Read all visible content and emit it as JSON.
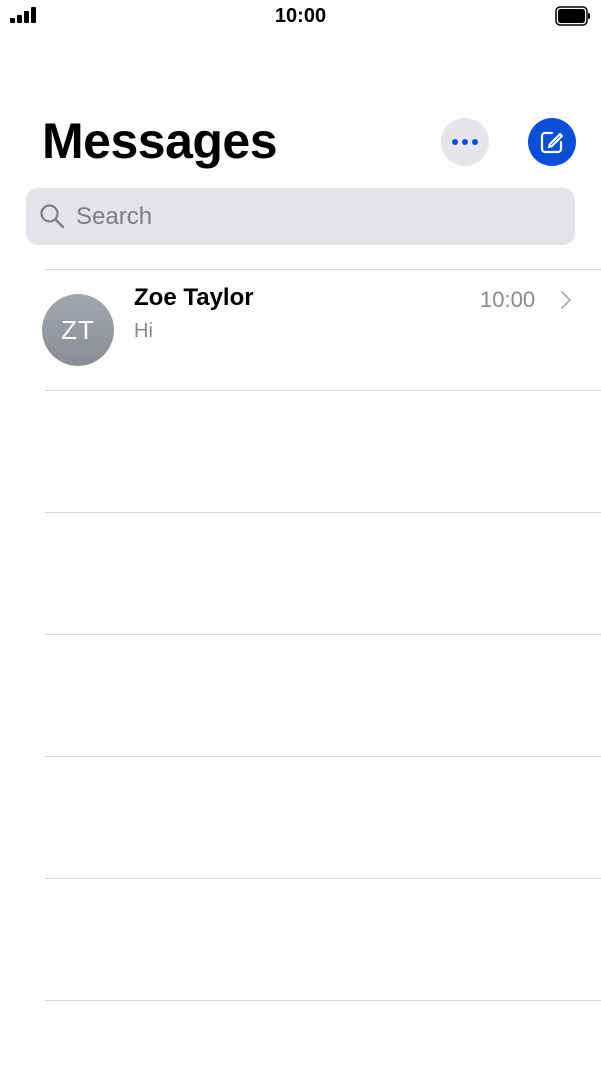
{
  "status_bar": {
    "time": "10:00"
  },
  "header": {
    "title": "Messages",
    "more_icon": "ellipsis-icon",
    "compose_icon": "compose-icon"
  },
  "search": {
    "placeholder": "Search",
    "value": ""
  },
  "conversations": [
    {
      "initials": "ZT",
      "name": "Zoe Taylor",
      "preview": "Hi",
      "time": "10:00"
    }
  ],
  "colors": {
    "accent": "#0a4fd6",
    "secondary_text": "#8a8a8e",
    "search_bg": "#e3e3e8"
  }
}
